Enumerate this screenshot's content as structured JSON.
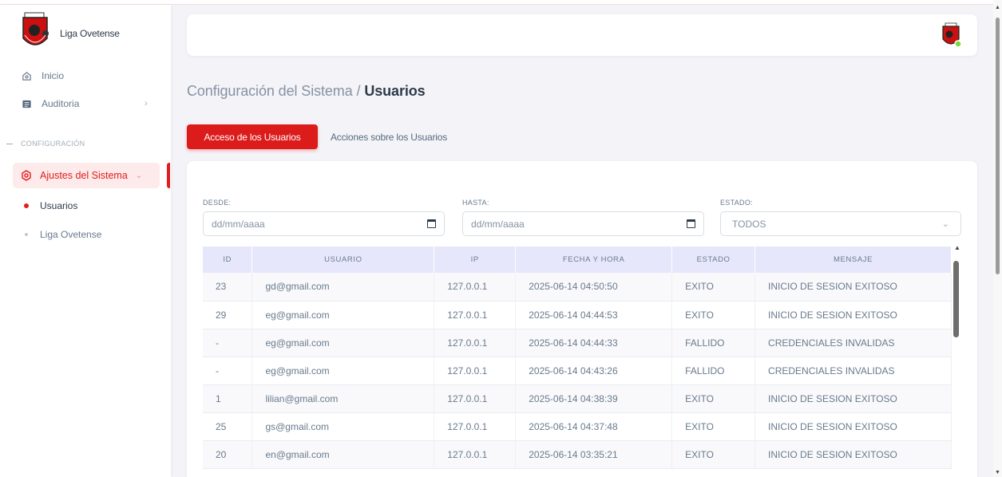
{
  "brand": {
    "name": "Liga Ovetense"
  },
  "sidebar": {
    "inicio": "Inicio",
    "auditoria": "Auditoria",
    "section": "CONFIGURACIÓN",
    "ajustes": "Ajustes del Sistema",
    "sub_items": [
      "Usuarios",
      "Liga Ovetense"
    ]
  },
  "breadcrumb": {
    "parent": "Configuración del Sistema / ",
    "current": "Usuarios"
  },
  "tabs": {
    "active": "Acceso de los Usuarios",
    "inactive": "Acciones sobre los Usuarios"
  },
  "filters": {
    "desde_label": "DESDE:",
    "desde_placeholder": "dd/mm/aaaa",
    "hasta_label": "HASTA:",
    "hasta_placeholder": "dd/mm/aaaa",
    "estado_label": "ESTADO:",
    "estado_value": "TODOS"
  },
  "table": {
    "headers": [
      "ID",
      "USUARIO",
      "IP",
      "FECHA Y HORA",
      "ESTADO",
      "MENSAJE"
    ],
    "rows": [
      [
        "23",
        "gd@gmail.com",
        "127.0.0.1",
        "2025-06-14 04:50:50",
        "EXITO",
        "INICIO DE SESION EXITOSO"
      ],
      [
        "29",
        "eg@gmail.com",
        "127.0.0.1",
        "2025-06-14 04:44:53",
        "EXITO",
        "INICIO DE SESION EXITOSO"
      ],
      [
        "-",
        "eg@gmail.com",
        "127.0.0.1",
        "2025-06-14 04:44:33",
        "FALLIDO",
        "CREDENCIALES INVALIDAS"
      ],
      [
        "-",
        "eg@gmail.com",
        "127.0.0.1",
        "2025-06-14 04:43:26",
        "FALLIDO",
        "CREDENCIALES INVALIDAS"
      ],
      [
        "1",
        "lilian@gmail.com",
        "127.0.0.1",
        "2025-06-14 04:38:39",
        "EXITO",
        "INICIO DE SESION EXITOSO"
      ],
      [
        "25",
        "gs@gmail.com",
        "127.0.0.1",
        "2025-06-14 04:37:48",
        "EXITO",
        "INICIO DE SESION EXITOSO"
      ],
      [
        "20",
        "en@gmail.com",
        "127.0.0.1",
        "2025-06-14 03:35:21",
        "EXITO",
        "INICIO DE SESION EXITOSO"
      ]
    ]
  },
  "colors": {
    "accent": "#dc1b1b",
    "active_bg": "#fdeaea",
    "table_header_bg": "#e7e7fb"
  },
  "icons": [
    "home-icon",
    "ledger-icon",
    "chevron-right-icon",
    "gear-icon",
    "chevron-down-icon",
    "calendar-icon"
  ]
}
